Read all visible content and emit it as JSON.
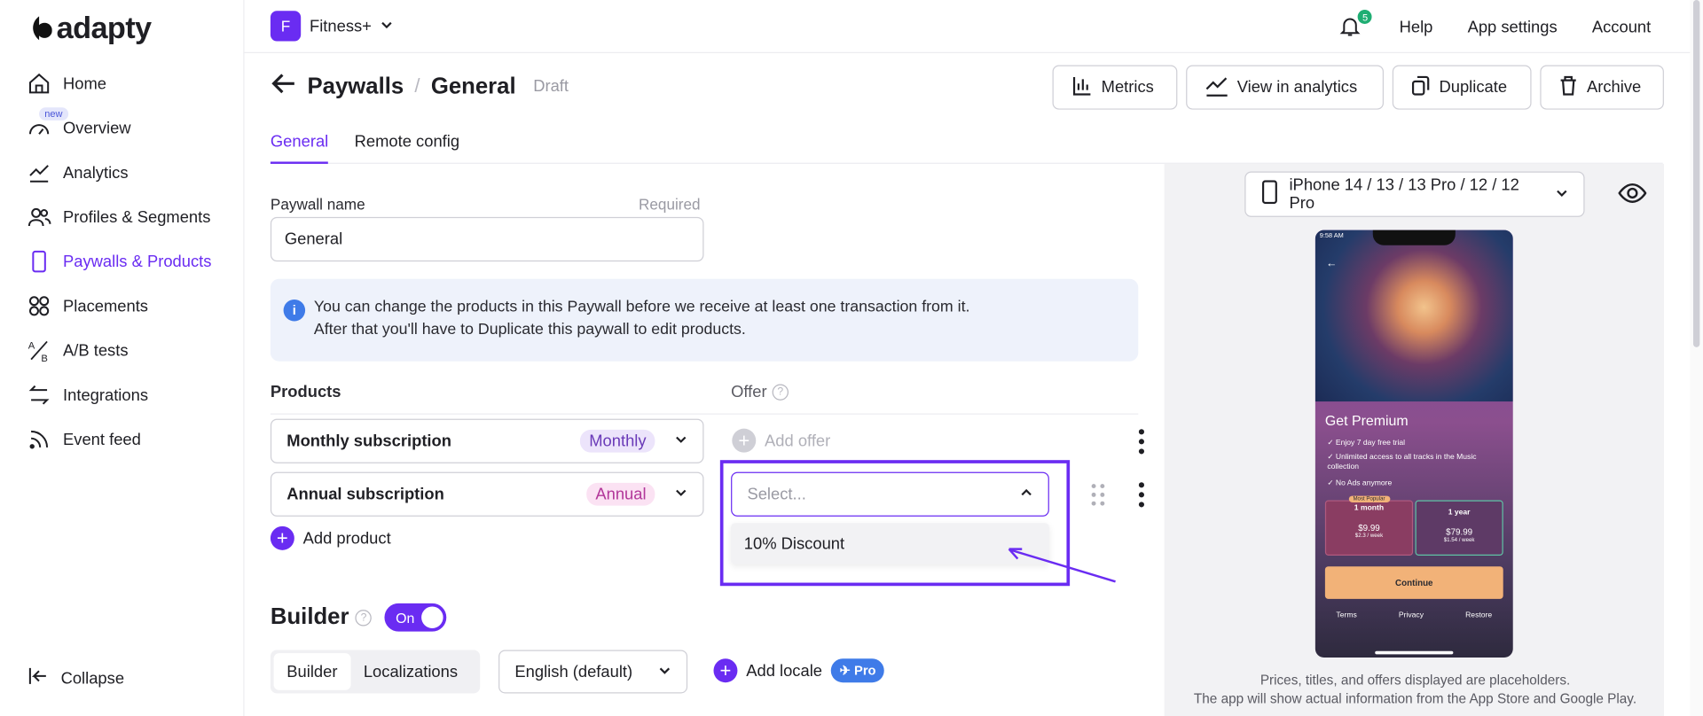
{
  "brand": {
    "name": "adapty"
  },
  "sidebar": {
    "items": [
      {
        "label": "Home",
        "icon": "home-icon"
      },
      {
        "label": "Overview",
        "icon": "gauge-icon",
        "badge": "new"
      },
      {
        "label": "Analytics",
        "icon": "line-chart-icon"
      },
      {
        "label": "Profiles & Segments",
        "icon": "users-icon"
      },
      {
        "label": "Paywalls & Products",
        "icon": "phone-icon",
        "active": true
      },
      {
        "label": "Placements",
        "icon": "grid-icon"
      },
      {
        "label": "A/B tests",
        "icon": "ab-icon"
      },
      {
        "label": "Integrations",
        "icon": "swap-icon"
      },
      {
        "label": "Event feed",
        "icon": "rss-icon"
      }
    ],
    "collapse_label": "Collapse"
  },
  "topbar": {
    "app_initial": "F",
    "app_name": "Fitness+",
    "notifications": "5",
    "help": "Help",
    "app_settings": "App settings",
    "account": "Account"
  },
  "page": {
    "title": "Paywalls",
    "subtitle": "General",
    "status": "Draft"
  },
  "actions": {
    "metrics": "Metrics",
    "view_analytics": "View in analytics",
    "duplicate": "Duplicate",
    "archive": "Archive"
  },
  "tabs": {
    "general": "General",
    "remote_config": "Remote config"
  },
  "form": {
    "paywall_name_label": "Paywall name",
    "required": "Required",
    "paywall_name_value": "General",
    "info_line1": "You can change the products in this Paywall before we receive at least one transaction from it.",
    "info_line2": "After that you'll have to Duplicate this paywall to edit products.",
    "products_label": "Products",
    "offer_label": "Offer",
    "products": [
      {
        "name": "Monthly subscription",
        "period": "Monthly",
        "pill_bg": "#ece4fb",
        "pill_color": "#6a3ab8"
      },
      {
        "name": "Annual subscription",
        "period": "Annual",
        "pill_bg": "#fbe2f3",
        "pill_color": "#b2379a"
      }
    ],
    "add_offer": "Add offer",
    "offer_select_placeholder": "Select...",
    "offer_option": "10% Discount",
    "add_product": "Add product"
  },
  "builder": {
    "title": "Builder",
    "toggle": "On",
    "seg_builder": "Builder",
    "seg_localizations": "Localizations",
    "language": "English (default)",
    "add_locale": "Add locale",
    "pro": "Pro"
  },
  "preview": {
    "device": "iPhone 14 / 13 / 13 Pro / 12 / 12 Pro",
    "phone": {
      "time": "9:58 AM",
      "title": "Get Premium",
      "features": [
        "Enjoy 7 day free trial",
        "Unlimited access to all tracks in the Music collection",
        "No Ads anymore"
      ],
      "plans": [
        {
          "badge": "Most Popular",
          "name": "1 month",
          "price": "$9.99",
          "per": "$2.3 / week"
        },
        {
          "name": "1 year",
          "price": "$79.99",
          "per": "$1.54 / week"
        }
      ],
      "cta": "Continue",
      "links": [
        "Terms",
        "Privacy",
        "Restore"
      ]
    },
    "disclaimer1": "Prices, titles, and offers displayed are placeholders.",
    "disclaimer2": "The app will show actual information from the App Store and Google Play."
  },
  "colors": {
    "accent": "#6a2cf2",
    "info_bg": "#eef2fb",
    "pro": "#3f7be8"
  }
}
